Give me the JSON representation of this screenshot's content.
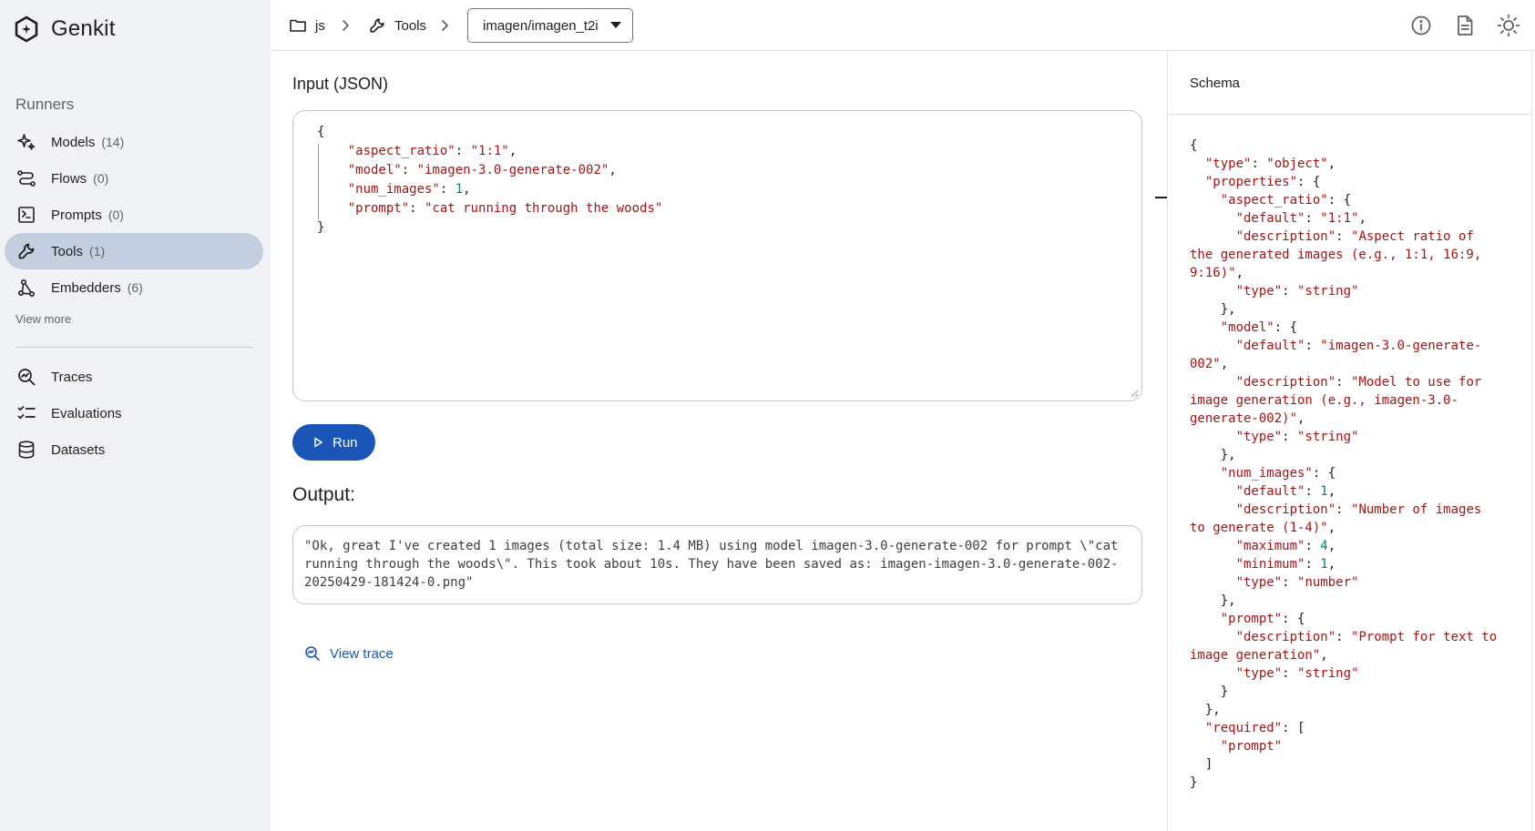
{
  "app": {
    "name": "Genkit",
    "logo_icon": "genkit-logo-icon"
  },
  "sidebar": {
    "section_title": "Runners",
    "items": [
      {
        "label": "Models",
        "count": "(14)",
        "icon": "sparkle-icon",
        "active": false
      },
      {
        "label": "Flows",
        "count": "(0)",
        "icon": "flow-icon",
        "active": false
      },
      {
        "label": "Prompts",
        "count": "(0)",
        "icon": "prompt-icon",
        "active": false
      },
      {
        "label": "Tools",
        "count": "(1)",
        "icon": "wrench-icon",
        "active": true
      },
      {
        "label": "Embedders",
        "count": "(6)",
        "icon": "embedder-icon",
        "active": false
      }
    ],
    "view_more": "View more",
    "secondary_items": [
      {
        "label": "Traces",
        "icon": "traces-icon"
      },
      {
        "label": "Evaluations",
        "icon": "evaluations-icon"
      },
      {
        "label": "Datasets",
        "icon": "database-icon"
      }
    ]
  },
  "header": {
    "breadcrumb": [
      {
        "label": "js",
        "icon": "folder-icon"
      },
      {
        "label": "Tools",
        "icon": "wrench-icon"
      }
    ],
    "selector_value": "imagen/imagen_t2i",
    "icons": [
      "info-icon",
      "docs-icon",
      "theme-icon"
    ]
  },
  "input": {
    "title": "Input (JSON)",
    "lines": [
      [
        [
          "p",
          "{"
        ]
      ],
      [
        [
          "p",
          "    "
        ],
        [
          "k",
          "\"aspect_ratio\""
        ],
        [
          "p",
          ": "
        ],
        [
          "s",
          "\"1:1\""
        ],
        [
          "p",
          ","
        ]
      ],
      [
        [
          "p",
          "    "
        ],
        [
          "k",
          "\"model\""
        ],
        [
          "p",
          ": "
        ],
        [
          "s",
          "\"imagen-3.0-generate-002\""
        ],
        [
          "p",
          ","
        ]
      ],
      [
        [
          "p",
          "    "
        ],
        [
          "k",
          "\"num_images\""
        ],
        [
          "p",
          ": "
        ],
        [
          "n",
          "1"
        ],
        [
          "p",
          ","
        ]
      ],
      [
        [
          "p",
          "    "
        ],
        [
          "k",
          "\"prompt\""
        ],
        [
          "p",
          ": "
        ],
        [
          "s",
          "\"cat running through the woods\""
        ]
      ],
      [
        [
          "p",
          "}"
        ]
      ]
    ]
  },
  "run_button": {
    "label": "Run",
    "icon": "play-icon"
  },
  "output": {
    "title": "Output:",
    "text": "\"Ok, great I've created 1 images (total size: 1.4 MB) using model imagen-3.0-generate-002 for prompt \\\"cat running through the woods\\\". This took about 10s. They have been saved as: imagen-imagen-3.0-generate-002-20250429-181424-0.png\""
  },
  "view_trace": {
    "label": "View trace",
    "icon": "trace-search-icon"
  },
  "schema": {
    "title": "Schema",
    "lines": [
      [
        [
          "p",
          "{"
        ]
      ],
      [
        [
          "p",
          "  "
        ],
        [
          "k",
          "\"type\""
        ],
        [
          "p",
          ": "
        ],
        [
          "s",
          "\"object\""
        ],
        [
          "p",
          ","
        ]
      ],
      [
        [
          "p",
          "  "
        ],
        [
          "k",
          "\"properties\""
        ],
        [
          "p",
          ": {"
        ]
      ],
      [
        [
          "p",
          "    "
        ],
        [
          "k",
          "\"aspect_ratio\""
        ],
        [
          "p",
          ": {"
        ]
      ],
      [
        [
          "p",
          "      "
        ],
        [
          "k",
          "\"default\""
        ],
        [
          "p",
          ": "
        ],
        [
          "s",
          "\"1:1\""
        ],
        [
          "p",
          ","
        ]
      ],
      [
        [
          "p",
          "      "
        ],
        [
          "k",
          "\"description\""
        ],
        [
          "p",
          ": "
        ],
        [
          "s",
          "\"Aspect ratio of"
        ]
      ],
      [
        [
          "s",
          "the generated images (e.g., 1:1, 16:9,"
        ]
      ],
      [
        [
          "s",
          "9:16)\""
        ],
        [
          "p",
          ","
        ]
      ],
      [
        [
          "p",
          "      "
        ],
        [
          "k",
          "\"type\""
        ],
        [
          "p",
          ": "
        ],
        [
          "s",
          "\"string\""
        ]
      ],
      [
        [
          "p",
          "    },"
        ]
      ],
      [
        [
          "p",
          "    "
        ],
        [
          "k",
          "\"model\""
        ],
        [
          "p",
          ": {"
        ]
      ],
      [
        [
          "p",
          "      "
        ],
        [
          "k",
          "\"default\""
        ],
        [
          "p",
          ": "
        ],
        [
          "s",
          "\"imagen-3.0-generate-"
        ]
      ],
      [
        [
          "s",
          "002\""
        ],
        [
          "p",
          ","
        ]
      ],
      [
        [
          "p",
          "      "
        ],
        [
          "k",
          "\"description\""
        ],
        [
          "p",
          ": "
        ],
        [
          "s",
          "\"Model to use for"
        ]
      ],
      [
        [
          "s",
          "image generation (e.g., imagen-3.0-"
        ]
      ],
      [
        [
          "s",
          "generate-002)\""
        ],
        [
          "p",
          ","
        ]
      ],
      [
        [
          "p",
          "      "
        ],
        [
          "k",
          "\"type\""
        ],
        [
          "p",
          ": "
        ],
        [
          "s",
          "\"string\""
        ]
      ],
      [
        [
          "p",
          "    },"
        ]
      ],
      [
        [
          "p",
          "    "
        ],
        [
          "k",
          "\"num_images\""
        ],
        [
          "p",
          ": {"
        ]
      ],
      [
        [
          "p",
          "      "
        ],
        [
          "k",
          "\"default\""
        ],
        [
          "p",
          ": "
        ],
        [
          "n",
          "1"
        ],
        [
          "p",
          ","
        ]
      ],
      [
        [
          "p",
          "      "
        ],
        [
          "k",
          "\"description\""
        ],
        [
          "p",
          ": "
        ],
        [
          "s",
          "\"Number of images"
        ]
      ],
      [
        [
          "s",
          "to generate (1-4)\""
        ],
        [
          "p",
          ","
        ]
      ],
      [
        [
          "p",
          "      "
        ],
        [
          "k",
          "\"maximum\""
        ],
        [
          "p",
          ": "
        ],
        [
          "n",
          "4"
        ],
        [
          "p",
          ","
        ]
      ],
      [
        [
          "p",
          "      "
        ],
        [
          "k",
          "\"minimum\""
        ],
        [
          "p",
          ": "
        ],
        [
          "n",
          "1"
        ],
        [
          "p",
          ","
        ]
      ],
      [
        [
          "p",
          "      "
        ],
        [
          "k",
          "\"type\""
        ],
        [
          "p",
          ": "
        ],
        [
          "s",
          "\"number\""
        ]
      ],
      [
        [
          "p",
          "    },"
        ]
      ],
      [
        [
          "p",
          "    "
        ],
        [
          "k",
          "\"prompt\""
        ],
        [
          "p",
          ": {"
        ]
      ],
      [
        [
          "p",
          "      "
        ],
        [
          "k",
          "\"description\""
        ],
        [
          "p",
          ": "
        ],
        [
          "s",
          "\"Prompt for text to"
        ]
      ],
      [
        [
          "s",
          "image generation\""
        ],
        [
          "p",
          ","
        ]
      ],
      [
        [
          "p",
          "      "
        ],
        [
          "k",
          "\"type\""
        ],
        [
          "p",
          ": "
        ],
        [
          "s",
          "\"string\""
        ]
      ],
      [
        [
          "p",
          "    }"
        ]
      ],
      [
        [
          "p",
          "  },"
        ]
      ],
      [
        [
          "p",
          "  "
        ],
        [
          "k",
          "\"required\""
        ],
        [
          "p",
          ": ["
        ]
      ],
      [
        [
          "p",
          "    "
        ],
        [
          "s",
          "\"prompt\""
        ]
      ],
      [
        [
          "p",
          "  ]"
        ]
      ],
      [
        [
          "p",
          "}"
        ]
      ]
    ]
  },
  "colors": {
    "accent": "#1a56b8",
    "active_nav": "#c3cfe1",
    "sidebar_bg": "#f1f2f5",
    "json_key": "#a31515",
    "json_number": "#098658"
  }
}
